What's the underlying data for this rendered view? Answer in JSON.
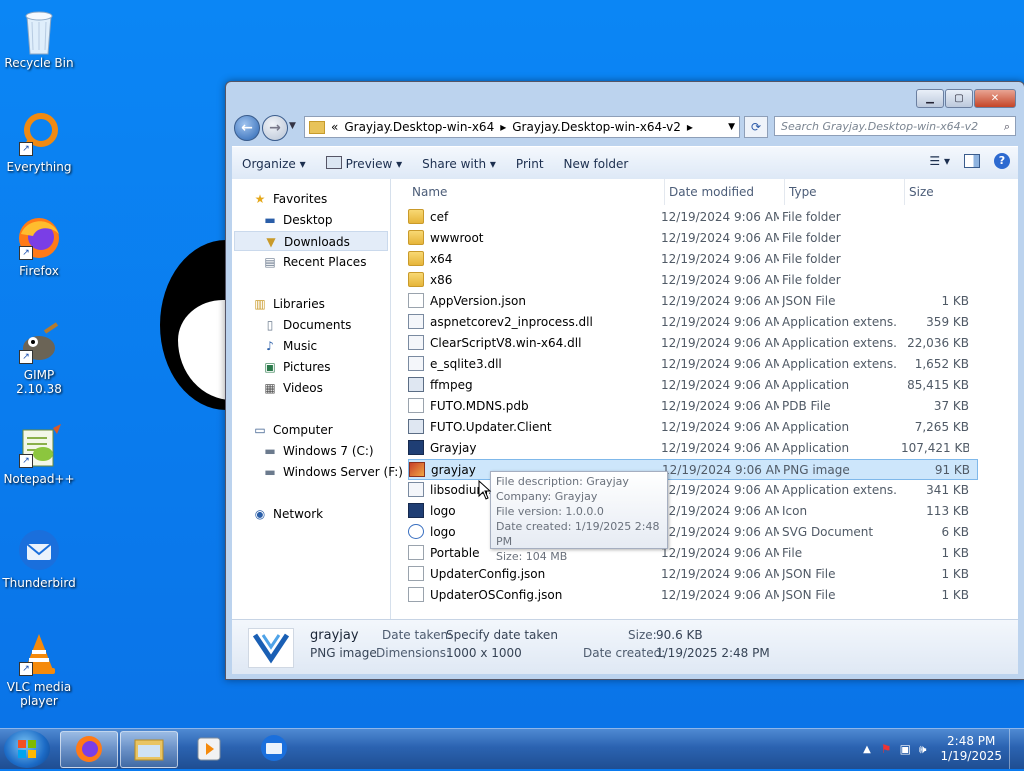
{
  "desktop": {
    "icons": [
      {
        "label": "Recycle Bin",
        "icon": "recycle-bin-icon"
      },
      {
        "label": "Everything",
        "icon": "everything-icon"
      },
      {
        "label": "Firefox",
        "icon": "firefox-icon"
      },
      {
        "label": "GIMP 2.10.38",
        "icon": "gimp-icon"
      },
      {
        "label": "Notepad++",
        "icon": "notepadpp-icon"
      },
      {
        "label": "Thunderbird",
        "icon": "thunderbird-icon"
      },
      {
        "label": "VLC media player",
        "icon": "vlc-icon"
      }
    ]
  },
  "explorer": {
    "breadcrumb": {
      "overflow": "«",
      "parts": [
        "Grayjay.Desktop-win-x64",
        "Grayjay.Desktop-win-x64-v2"
      ]
    },
    "search_placeholder": "Search Grayjay.Desktop-win-x64-v2",
    "toolbar": {
      "organize": "Organize",
      "preview": "Preview",
      "share_with": "Share with",
      "print": "Print",
      "new_folder": "New folder"
    },
    "nav": {
      "favorites": "Favorites",
      "desktop": "Desktop",
      "downloads": "Downloads",
      "recent_places": "Recent Places",
      "libraries": "Libraries",
      "documents": "Documents",
      "music": "Music",
      "pictures": "Pictures",
      "videos": "Videos",
      "computer": "Computer",
      "drive_c": "Windows 7 (C:)",
      "drive_f": "Windows Server (F:)",
      "network": "Network"
    },
    "columns": {
      "name": "Name",
      "date_modified": "Date modified",
      "type": "Type",
      "size": "Size"
    },
    "files": [
      {
        "name": "cef",
        "date": "12/19/2024 9:06 AM",
        "type": "File folder",
        "size": "",
        "icon": "folder"
      },
      {
        "name": "wwwroot",
        "date": "12/19/2024 9:06 AM",
        "type": "File folder",
        "size": "",
        "icon": "folder"
      },
      {
        "name": "x64",
        "date": "12/19/2024 9:06 AM",
        "type": "File folder",
        "size": "",
        "icon": "folder"
      },
      {
        "name": "x86",
        "date": "12/19/2024 9:06 AM",
        "type": "File folder",
        "size": "",
        "icon": "folder"
      },
      {
        "name": "AppVersion.json",
        "date": "12/19/2024 9:06 AM",
        "type": "JSON File",
        "size": "1 KB",
        "icon": "doc"
      },
      {
        "name": "aspnetcorev2_inprocess.dll",
        "date": "12/19/2024 9:06 AM",
        "type": "Application extens...",
        "size": "359 KB",
        "icon": "dll"
      },
      {
        "name": "ClearScriptV8.win-x64.dll",
        "date": "12/19/2024 9:06 AM",
        "type": "Application extens...",
        "size": "22,036 KB",
        "icon": "dll"
      },
      {
        "name": "e_sqlite3.dll",
        "date": "12/19/2024 9:06 AM",
        "type": "Application extens...",
        "size": "1,652 KB",
        "icon": "dll"
      },
      {
        "name": "ffmpeg",
        "date": "12/19/2024 9:06 AM",
        "type": "Application",
        "size": "85,415 KB",
        "icon": "app"
      },
      {
        "name": "FUTO.MDNS.pdb",
        "date": "12/19/2024 9:06 AM",
        "type": "PDB File",
        "size": "37 KB",
        "icon": "doc"
      },
      {
        "name": "FUTO.Updater.Client",
        "date": "12/19/2024 9:06 AM",
        "type": "Application",
        "size": "7,265 KB",
        "icon": "app"
      },
      {
        "name": "Grayjay",
        "date": "12/19/2024 9:06 AM",
        "type": "Application",
        "size": "107,421 KB",
        "icon": "gj"
      },
      {
        "name": "grayjay",
        "date": "12/19/2024 9:06 AM",
        "type": "PNG image",
        "size": "91 KB",
        "icon": "png",
        "selected": true
      },
      {
        "name": "libsodium.dll",
        "date": "12/19/2024 9:06 AM",
        "type": "Application extens...",
        "size": "341 KB",
        "icon": "dll"
      },
      {
        "name": "logo",
        "date": "12/19/2024 9:06 AM",
        "type": "Icon",
        "size": "113 KB",
        "icon": "gj"
      },
      {
        "name": "logo",
        "date": "12/19/2024 9:06 AM",
        "type": "SVG Document",
        "size": "6 KB",
        "icon": "svg"
      },
      {
        "name": "Portable",
        "date": "12/19/2024 9:06 AM",
        "type": "File",
        "size": "1 KB",
        "icon": "doc"
      },
      {
        "name": "UpdaterConfig.json",
        "date": "12/19/2024 9:06 AM",
        "type": "JSON File",
        "size": "1 KB",
        "icon": "doc"
      },
      {
        "name": "UpdaterOSConfig.json",
        "date": "12/19/2024 9:06 AM",
        "type": "JSON File",
        "size": "1 KB",
        "icon": "doc"
      }
    ],
    "tooltip": {
      "description": "File description: Grayjay",
      "company": "Company: Grayjay",
      "version": "File version: 1.0.0.0",
      "created": "Date created: 1/19/2025 2:48 PM",
      "size": "Size: 104 MB"
    },
    "details": {
      "name": "grayjay",
      "type": "PNG image",
      "date_taken_label": "Date taken:",
      "date_taken_value": "Specify date taken",
      "dimensions_label": "Dimensions:",
      "dimensions_value": "1000 x 1000",
      "size_label": "Size:",
      "size_value": "90.6 KB",
      "created_label": "Date created:",
      "created_value": "1/19/2025 2:48 PM"
    }
  },
  "taskbar": {
    "pinned": [
      "firefox-icon",
      "explorer-icon",
      "media-player-icon",
      "thunderbird-icon"
    ],
    "clock_time": "2:48 PM",
    "clock_date": "1/19/2025"
  }
}
